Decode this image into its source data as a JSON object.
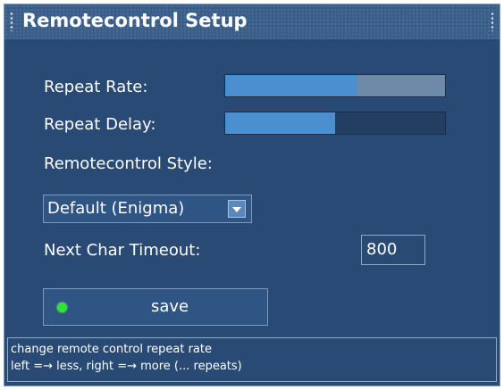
{
  "window": {
    "title": "Remotecontrol Setup"
  },
  "settings": {
    "repeat_rate": {
      "label": "Repeat Rate:",
      "level": 0.6
    },
    "repeat_delay": {
      "label": "Repeat Delay:",
      "level": 0.5
    },
    "remote_style": {
      "label": "Remotecontrol Style:",
      "selected": "Default (Enigma)"
    },
    "next_char_timeout": {
      "label": "Next Char Timeout:",
      "value": "800"
    },
    "save_label": "save"
  },
  "status": {
    "line1": "change remote control repeat rate",
    "line2": "left =→ less, right =→ more (... repeats)"
  },
  "colors": {
    "window_bg": "#284a74",
    "bar_fill": "#4b8fcf",
    "save_indicator": "#2fe234"
  },
  "icons": {
    "dropdown": "chevron-down-icon",
    "save_indicator": "green-dot-icon"
  }
}
